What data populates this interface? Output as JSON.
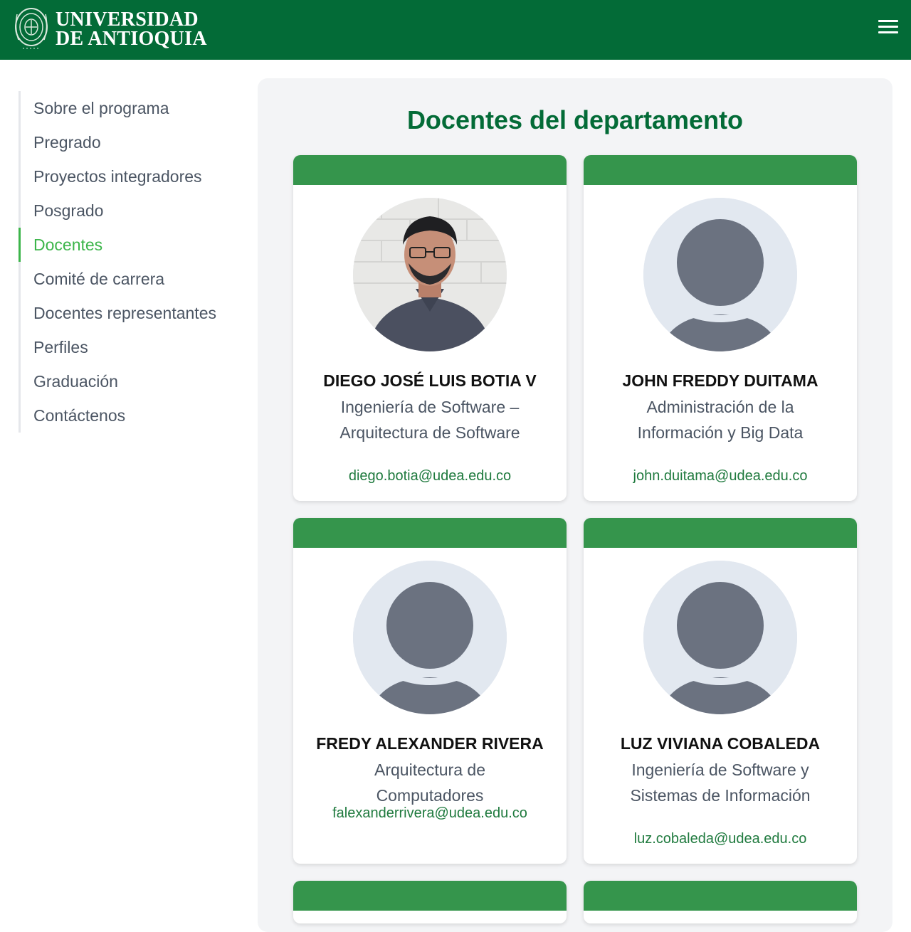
{
  "header": {
    "logo_line1": "UNIVERSIDAD",
    "logo_line2": "DE ANTIOQUIA",
    "logo_seal_icon": "university-seal-icon",
    "menu_icon": "hamburger-menu-icon",
    "bg_color": "#036b37"
  },
  "sidebar": {
    "items": [
      {
        "label": "Sobre el programa",
        "active": false
      },
      {
        "label": "Pregrado",
        "active": false
      },
      {
        "label": "Proyectos integradores",
        "active": false
      },
      {
        "label": "Posgrado",
        "active": false
      },
      {
        "label": "Docentes",
        "active": true
      },
      {
        "label": "Comité de carrera",
        "active": false
      },
      {
        "label": "Docentes representantes",
        "active": false
      },
      {
        "label": "Perfiles",
        "active": false
      },
      {
        "label": "Graduación",
        "active": false
      },
      {
        "label": "Contáctenos",
        "active": false
      }
    ],
    "active_color": "#3cb54a"
  },
  "main": {
    "title": "Docentes del departamento",
    "cards": [
      {
        "name": "DIEGO JOSÉ LUIS BOTIA V",
        "role": "Ingeniería de Software – Arquitectura de Software",
        "email": "diego.botia@udea.edu.co",
        "avatar": "photo"
      },
      {
        "name": "JOHN FREDDY DUITAMA",
        "role": "Administración de la Información y Big Data",
        "email": "john.duitama@udea.edu.co",
        "avatar": "default-user-icon"
      },
      {
        "name": "FREDY ALEXANDER RIVERA",
        "role": "Arquitectura de Computadores",
        "email": "falexanderrivera@udea.edu.co",
        "avatar": "default-user-icon"
      },
      {
        "name": "LUZ VIVIANA COBALEDA",
        "role": "Ingeniería de Software y Sistemas de Información",
        "email": "luz.cobaleda@udea.edu.co",
        "avatar": "default-user-icon"
      }
    ],
    "card_header_color": "#35954c",
    "title_color": "#036b37"
  }
}
